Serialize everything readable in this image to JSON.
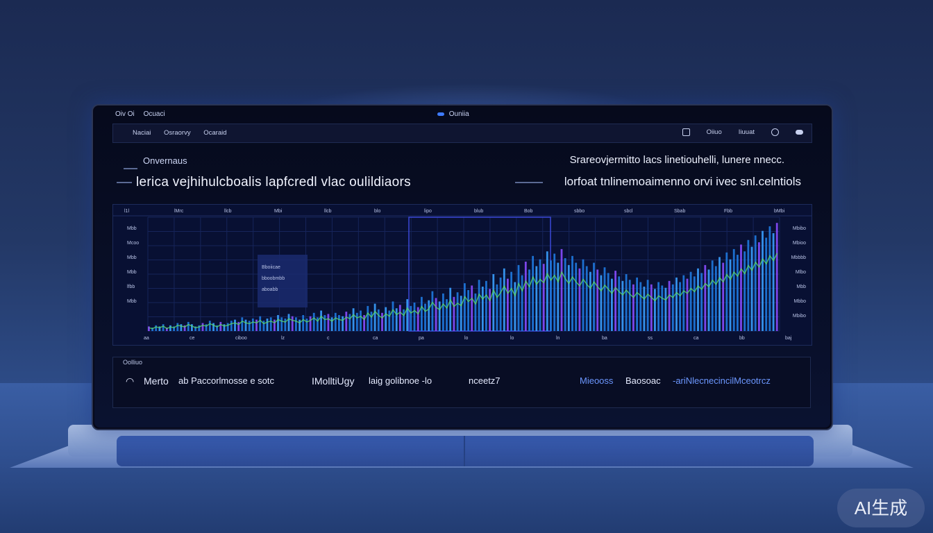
{
  "os_bar": {
    "left_items": [
      "Oiv Oi",
      "Ocuaci"
    ],
    "center": "Ouniia"
  },
  "app_nav": {
    "tabs": [
      "Naciai",
      "Osraorvy",
      "Ocaraid"
    ],
    "right_items": [
      "Oiiuo",
      "Iiuuat"
    ]
  },
  "overview": {
    "heading": "Onvernaus",
    "main": "lerica vejhihulcboalis lapfcredl vlac oulildiaors",
    "right_line1": "Srareovjermitto lacs linetiouhelli, lunere nnecc.",
    "right_line2": "lorfoat tnlinemoaimenno orvi ivec snl.celntiols"
  },
  "metrics": {
    "label": "Oolliuo",
    "items": [
      "Merto",
      "ab Paccorlmosse e sotc",
      "IMolltiUgy",
      "laig golibnoe -lo",
      "nceetz7",
      "Mieooss",
      "Baosoac",
      "-ariNlecnecincilMceotrcz"
    ]
  },
  "chart_data": {
    "type": "bar",
    "title": "",
    "ylim": [
      0,
      100
    ],
    "grid": true,
    "top_labels": [
      "l1l",
      "lMrc",
      "llcb",
      "Mbi",
      "llcb",
      "blo",
      "lipo",
      "blub",
      "Bob",
      "sbbo",
      "sbcl",
      "Sbab",
      "Fbb",
      "bMbi"
    ],
    "left_labels": [
      "Mbb",
      "Mcoo",
      "Mbb",
      "Mbb",
      "lfbb",
      "Mbb"
    ],
    "right_labels": [
      "Mbibo",
      "Mbioo",
      "Mbbbb",
      "Mlbo",
      "Mbb",
      "Mbbo",
      "Mbibo"
    ],
    "bottom_labels": [
      "aa",
      "ce",
      "ciboo",
      "lz",
      "c",
      "ca",
      "pa",
      "lo",
      "lo",
      "ln",
      "ba",
      "ss",
      "ca",
      "bb",
      "baj"
    ],
    "tooltip_lines": [
      "Bboiicae",
      "bboobmbb",
      "aboabb"
    ],
    "values": [
      4,
      3,
      5,
      4,
      6,
      3,
      5,
      4,
      7,
      6,
      5,
      8,
      6,
      4,
      5,
      7,
      6,
      9,
      7,
      5,
      8,
      6,
      7,
      9,
      10,
      8,
      12,
      10,
      9,
      11,
      10,
      13,
      9,
      11,
      12,
      10,
      14,
      12,
      11,
      15,
      13,
      12,
      10,
      14,
      11,
      13,
      16,
      12,
      18,
      14,
      15,
      12,
      16,
      14,
      13,
      17,
      15,
      20,
      16,
      18,
      14,
      22,
      17,
      24,
      19,
      16,
      21,
      18,
      26,
      20,
      23,
      19,
      28,
      22,
      25,
      21,
      30,
      24,
      27,
      35,
      29,
      26,
      33,
      28,
      38,
      30,
      34,
      31,
      42,
      36,
      40,
      33,
      45,
      39,
      44,
      37,
      50,
      41,
      47,
      55,
      46,
      52,
      43,
      58,
      49,
      61,
      54,
      66,
      57,
      63,
      59,
      70,
      62,
      68,
      60,
      72,
      64,
      58,
      66,
      60,
      55,
      63,
      57,
      52,
      60,
      54,
      49,
      56,
      51,
      46,
      53,
      48,
      44,
      50,
      45,
      41,
      47,
      43,
      39,
      45,
      41,
      37,
      43,
      40,
      38,
      44,
      41,
      47,
      43,
      49,
      46,
      52,
      48,
      55,
      51,
      58,
      54,
      62,
      57,
      65,
      60,
      69,
      63,
      72,
      67,
      76,
      70,
      80,
      74,
      84,
      78,
      88,
      82,
      92,
      86,
      95
    ]
  }
}
